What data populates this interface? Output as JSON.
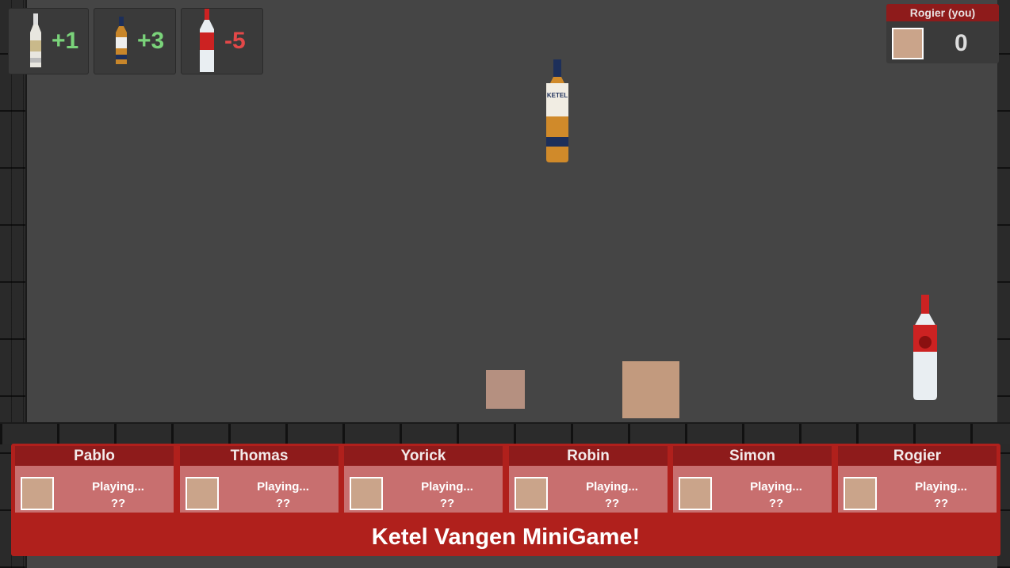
{
  "legend": [
    {
      "value": "+1",
      "bottle": "white-bottle"
    },
    {
      "value": "+3",
      "bottle": "amber-bottle"
    },
    {
      "value": "-5",
      "bottle": "red-label-bottle"
    }
  ],
  "you_panel": {
    "title": "Rogier (you)",
    "score": "0"
  },
  "players": [
    {
      "name": "Pablo",
      "status": "Playing...",
      "score": "??"
    },
    {
      "name": "Thomas",
      "status": "Playing...",
      "score": "??"
    },
    {
      "name": "Yorick",
      "status": "Playing...",
      "score": "??"
    },
    {
      "name": "Robin",
      "status": "Playing...",
      "score": "??"
    },
    {
      "name": "Simon",
      "status": "Playing...",
      "score": "??"
    },
    {
      "name": "Rogier",
      "status": "Playing...",
      "score": "??"
    }
  ],
  "game_title": "Ketel Vangen MiniGame!",
  "colors": {
    "panel_red": "#b0201c",
    "header_red": "#8e1b1b",
    "card": "#c86f6f",
    "positive": "#7ad37a",
    "negative": "#e34848",
    "floor": "#454545"
  }
}
